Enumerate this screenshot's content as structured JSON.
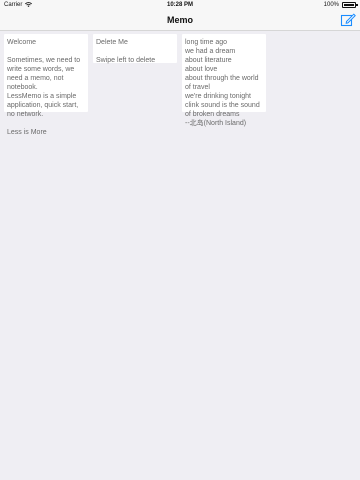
{
  "status_bar": {
    "carrier": "Carrier",
    "time": "10:28 PM",
    "battery": "100%"
  },
  "nav": {
    "title": "Memo"
  },
  "memos": [
    {
      "text": "Welcome\n\nSometimes, we need to write some words, we need a memo, not notebook.\nLessMemo is a simple application, quick start, no network.\n\nLess is More"
    },
    {
      "text": "Delete Me\n\nSwipe left to delete"
    },
    {
      "text": "long time ago\nwe had a dream\nabout literature\nabout love\nabout through the world of travel\nwe're drinking tonight\nclink sound is the sound of broken dreams\n--北岛(North Island)"
    }
  ],
  "icons": {
    "compose": "compose-icon",
    "wifi": "wifi-icon",
    "battery": "battery-icon"
  },
  "colors": {
    "accent": "#1a8cff",
    "background": "#efeef3",
    "card": "#ffffff"
  }
}
